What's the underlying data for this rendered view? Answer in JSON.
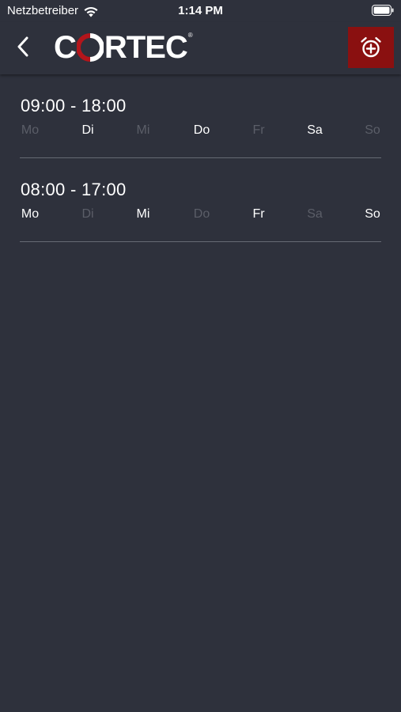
{
  "status_bar": {
    "carrier": "Netzbetreiber",
    "time": "1:14 PM"
  },
  "nav": {
    "logo_text_pre": "C",
    "logo_text_post": "RTEC",
    "logo_reg": "®",
    "back_icon": "chevron-left-icon",
    "action_icon": "alarm-add-icon"
  },
  "colors": {
    "background": "#2e313c",
    "accent": "#8a1010",
    "day_active": "#ffffff",
    "day_inactive": "#5b5e68",
    "divider": "#666a74"
  },
  "schedules": [
    {
      "time": "09:00 - 18:00",
      "days": [
        {
          "label": "Mo",
          "active": false
        },
        {
          "label": "Di",
          "active": true
        },
        {
          "label": "Mi",
          "active": false
        },
        {
          "label": "Do",
          "active": true
        },
        {
          "label": "Fr",
          "active": false
        },
        {
          "label": "Sa",
          "active": true
        },
        {
          "label": "So",
          "active": false
        }
      ]
    },
    {
      "time": "08:00 - 17:00",
      "days": [
        {
          "label": "Mo",
          "active": true
        },
        {
          "label": "Di",
          "active": false
        },
        {
          "label": "Mi",
          "active": true
        },
        {
          "label": "Do",
          "active": false
        },
        {
          "label": "Fr",
          "active": true
        },
        {
          "label": "Sa",
          "active": false
        },
        {
          "label": "So",
          "active": true
        }
      ]
    }
  ]
}
